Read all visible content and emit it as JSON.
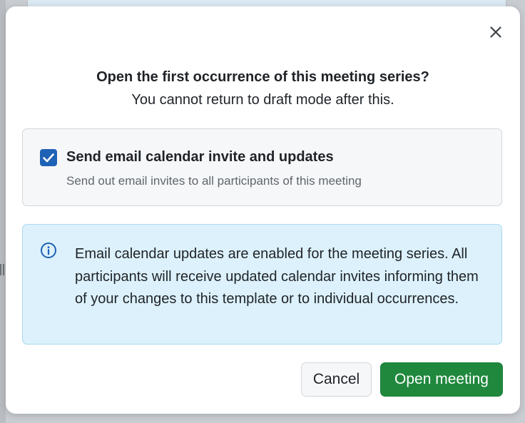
{
  "dialog": {
    "title": "Open the first occurrence of this meeting series?",
    "subtitle": "You cannot return to draft mode after this.",
    "close_icon": "close-icon",
    "email_option": {
      "checked": true,
      "label": "Send email calendar invite and updates",
      "description": "Send out email invites to all participants of this meeting",
      "checkbox_color": "#1e62b5"
    },
    "info_banner": {
      "icon": "info-icon",
      "text": "Email calendar updates are enabled for the meeting series. All participants will receive updated calendar invites informing them of your changes to this template or to individual occurrences.",
      "background_color": "#dcf1fb",
      "icon_color": "#1e62b5"
    },
    "actions": {
      "cancel_label": "Cancel",
      "confirm_label": "Open meeting",
      "confirm_color": "#1f883d"
    }
  }
}
